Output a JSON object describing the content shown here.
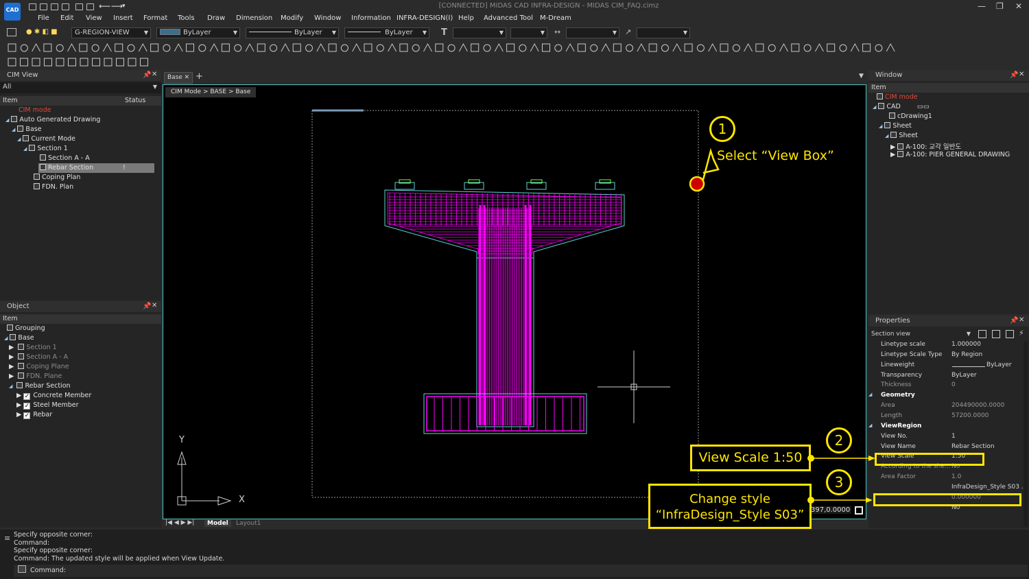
{
  "app": {
    "title": "[CONNECTED] MIDAS CAD INFRA-DESIGN - MIDAS CIM_FAQ.cimz",
    "logo": "CAD"
  },
  "menu": [
    "File",
    "Edit",
    "View",
    "Insert",
    "Format",
    "Tools",
    "Draw",
    "Dimension",
    "Modify",
    "Window",
    "Information",
    "INFRA-DESIGN(I)",
    "Help",
    "Advanced Tool",
    "M-Dream"
  ],
  "toolbar": {
    "layer": "G-REGION-VIEW",
    "color": "ByLayer",
    "linetype": "ByLayer",
    "lineweight": "ByLayer"
  },
  "cim_view": {
    "title": "CIM View",
    "filter": "All",
    "col_item": "Item",
    "col_status": "Status",
    "items": [
      {
        "label": "CIM mode"
      },
      {
        "label": "Auto Generated Drawing"
      },
      {
        "label": "Base"
      },
      {
        "label": "Current Mode"
      },
      {
        "label": "Section 1"
      },
      {
        "label": "Section A - A"
      },
      {
        "label": "Rebar Section"
      },
      {
        "label": "Coping Plan"
      },
      {
        "label": "FDN. Plan"
      }
    ]
  },
  "object_panel": {
    "title": "Object",
    "col_item": "Item",
    "items": [
      {
        "label": "Grouping"
      },
      {
        "label": "Base"
      },
      {
        "label": "Section 1"
      },
      {
        "label": "Section A - A"
      },
      {
        "label": "Coping Plane"
      },
      {
        "label": "FDN. Plane"
      },
      {
        "label": "Rebar Section"
      },
      {
        "label": "Concrete Member"
      },
      {
        "label": "Steel Member"
      },
      {
        "label": "Rebar"
      }
    ]
  },
  "doc": {
    "tab": "Base",
    "breadcrumb": "CIM Mode > BASE > Base",
    "axis_x": "X",
    "axis_y": "Y",
    "coord": "397,0.0000",
    "layout_tabs": [
      "Model",
      "Layout1"
    ]
  },
  "window_panel": {
    "title": "Window",
    "col_item": "Item",
    "items": [
      {
        "label": "CIM mode"
      },
      {
        "label": "CAD"
      },
      {
        "label": "cDrawing1"
      },
      {
        "label": "Sheet"
      },
      {
        "label": "Sheet"
      },
      {
        "label": "A-100: 교각 일반도"
      },
      {
        "label": "A-100: PIER GENERAL DRAWING"
      }
    ]
  },
  "properties": {
    "title": "Properties",
    "selector": "Section view",
    "rows": [
      {
        "k": "Linetype scale",
        "v": "1.000000"
      },
      {
        "k": "Linetype Scale Type",
        "v": "By Region"
      },
      {
        "k": "Lineweight",
        "v": "ByLayer"
      },
      {
        "k": "Transparency",
        "v": "ByLayer"
      },
      {
        "k": "Thickness",
        "v": "0"
      },
      {
        "k": "Geometry",
        "v": ""
      },
      {
        "k": "Area",
        "v": "204490000.0000"
      },
      {
        "k": "Length",
        "v": "57200.0000"
      },
      {
        "k": "ViewRegion",
        "v": ""
      },
      {
        "k": "View No.",
        "v": "1"
      },
      {
        "k": "View Name",
        "v": "Rebar Section"
      },
      {
        "k": "View Scale",
        "v": "1:50"
      },
      {
        "k": "According to the she...",
        "v": "No"
      },
      {
        "k": "Area Factor",
        "v": "1.0"
      },
      {
        "k": "",
        "v": "InfraDesign_Style S03 ..."
      },
      {
        "k": "",
        "v": "0.000000"
      },
      {
        "k": "",
        "v": "No"
      }
    ]
  },
  "annotations": {
    "step1_num": "1",
    "step1_text": "Select “View Box”",
    "step2_num": "2",
    "step2_text": "View Scale 1:50",
    "step3_num": "3",
    "step3_line1": "Change style",
    "step3_line2": "“InfraDesign_Style S03”",
    "accent": "#ffe600"
  },
  "command": {
    "lines": [
      "Specify opposite corner:",
      "Command:",
      "Specify opposite corner:",
      "Command:  The updated style will be applied when View Update."
    ],
    "prompt": "Command:"
  },
  "colors": {
    "rebar": "#ff00ff",
    "outline": "#5cd6d6",
    "viewport_border": "#4cc8c8"
  }
}
